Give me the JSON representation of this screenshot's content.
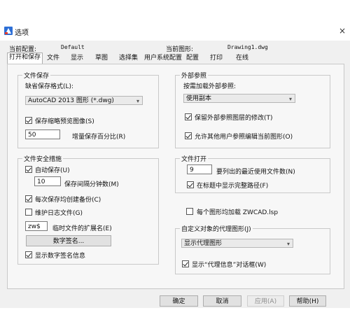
{
  "window": {
    "title": "选项",
    "close": "×"
  },
  "header": {
    "profile_label": "当前配置:",
    "profile_value": "Default",
    "drawing_label": "当前图形:",
    "drawing_value": "Drawing1.dwg"
  },
  "tabs": [
    "打开和保存",
    "文件",
    "显示",
    "草图",
    "选择集",
    "用户系统配置",
    "配置",
    "打印",
    "在线"
  ],
  "file_save": {
    "title": "文件保存",
    "format_label": "缺省保存格式(L):",
    "format_value": "AutoCAD 2013 图形 (*.dwg)",
    "thumbnail_label": "保存缩略预览图像(S)",
    "thumbnail_checked": true,
    "incremental_value": "50",
    "incremental_label": "增量保存百分比(R)"
  },
  "file_safety": {
    "title": "文件安全措施",
    "autosave_label": "自动保存(U)",
    "autosave_checked": true,
    "interval_value": "10",
    "interval_label": "保存间隔分钟数(M)",
    "backup_label": "每次保存均创建备份(C)",
    "backup_checked": true,
    "log_label": "维护日志文件(G)",
    "log_checked": false,
    "temp_ext_value": "zw$",
    "temp_ext_label": "临时文件的扩展名(E)",
    "signature_button": "数字签名...",
    "show_signature_label": "显示数字签名信息",
    "show_signature_checked": true
  },
  "xref": {
    "title": "外部参照",
    "load_label": "按需加载外部参照:",
    "load_value": "使用副本",
    "keep_changes_label": "保留外部参照图层的修改(T)",
    "keep_changes_checked": true,
    "allow_edit_label": "允许其他用户参照编辑当前图形(O)",
    "allow_edit_checked": true
  },
  "file_open": {
    "title": "文件打开",
    "recent_value": "9",
    "recent_label": "要列出的最近使用文件数(N)",
    "full_path_label": "在标题中显示完整路径(F)",
    "full_path_checked": true
  },
  "lsp": {
    "label": "每个图形均加载 ZWCAD.lsp",
    "checked": false
  },
  "proxy": {
    "title": "自定义对象的代理图形(J)",
    "value": "显示代理图形",
    "dialog_label": "显示“代理信息”对话框(W)",
    "dialog_checked": true
  },
  "buttons": {
    "ok": "确定",
    "cancel": "取消",
    "apply": "应用(A)",
    "help": "帮助(H)"
  },
  "icons": {
    "arrow": "▾"
  }
}
